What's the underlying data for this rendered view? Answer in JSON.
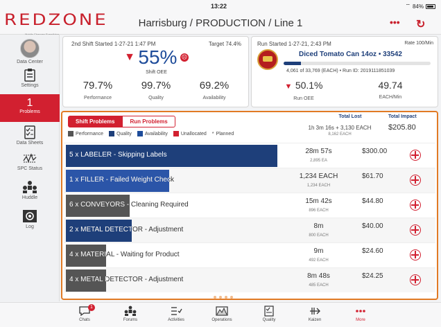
{
  "status_bar": {
    "time": "13:22",
    "battery": "84%"
  },
  "logo": {
    "text": "REDZONE",
    "tagline": "Mobile Changes Everything."
  },
  "header": {
    "title": "Harrisburg / PRODUCTION / Line 1",
    "more": "•••",
    "refresh": "↻"
  },
  "sidebar": {
    "items": [
      {
        "label": "Data Center",
        "icon": "user-avatar"
      },
      {
        "label": "Settings",
        "icon": "clipboard-icon"
      },
      {
        "label": "Problems",
        "count": "1",
        "icon": "problems"
      },
      {
        "label": "Data Sheets",
        "icon": "checklist-icon"
      },
      {
        "label": "SPC Status",
        "icon": "spc-chart-icon"
      },
      {
        "label": "Huddle",
        "icon": "huddle-icon"
      },
      {
        "label": "Log",
        "icon": "log-icon"
      }
    ]
  },
  "shift": {
    "started": "2nd Shift Started 1-27-21 1:47 PM",
    "target": "Target 74.4%",
    "oee": "55%",
    "oee_label": "Shift OEE",
    "metrics": [
      {
        "value": "79.7%",
        "label": "Performance"
      },
      {
        "value": "99.7%",
        "label": "Quality"
      },
      {
        "value": "69.2%",
        "label": "Availability"
      }
    ]
  },
  "run": {
    "started": "Run Started 1-27-21, 2:43 PM",
    "rate": "Rate 100/Min",
    "product": "Diced Tomato Can 14oz • 33542",
    "progress_fraction": 0.12,
    "count": "4,061 of 33,769 (EACH) • Run ID: 2019111851039",
    "oee": "50.1%",
    "oee_label": "Run OEE",
    "each_min": "49.74",
    "each_min_label": "EACH/Min"
  },
  "problems": {
    "tabs": [
      {
        "label": "Shift Problems",
        "active": true
      },
      {
        "label": "Run Problems",
        "active": false
      }
    ],
    "legend": [
      {
        "label": "Performance",
        "color": "#555555"
      },
      {
        "label": "Quality",
        "color": "#1e3f7a"
      },
      {
        "label": "Availability",
        "color": "#1e4c9a"
      },
      {
        "label": "Unallocated",
        "color": "#d22030"
      },
      {
        "label": "Planned",
        "marker": "*"
      }
    ],
    "headers": {
      "total_lost": "Total Lost",
      "total_impact": "Total Impact"
    },
    "totals": {
      "lost": "1h 3m 16s + 3,130 EACH",
      "each": "8,162 EACH",
      "impact": "$205.80"
    },
    "rows": [
      {
        "label": "5 x LABELER - Skipping Labels",
        "lost": "28m 57s",
        "lost_sub": "2,895 EA",
        "impact": "$300.00",
        "color": "#1e3f7a",
        "bar_fraction": 1.0
      },
      {
        "label": "1 x FILLER - Failed Weight Check",
        "lost": "1,234 EACH",
        "lost_sub": "1,234 EACH",
        "impact": "$61.70",
        "color": "#2b55a8",
        "bar_fraction": 0.49
      },
      {
        "label": "6 x CONVEYORS - Cleaning Required",
        "lost": "15m 42s",
        "lost_sub": "896 EACH",
        "impact": "$44.80",
        "color": "#555555",
        "bar_fraction": 0.3
      },
      {
        "label": "2 x METAL DETECTOR - Adjustment",
        "lost": "8m",
        "lost_sub": "800 EACH",
        "impact": "$40.00",
        "color": "#1e3f7a",
        "bar_fraction": 0.31
      },
      {
        "label": "4 x MATERIAL - Waiting for Product",
        "lost": "9m",
        "lost_sub": "492 EACH",
        "impact": "$24.60",
        "color": "#555555",
        "bar_fraction": 0.19
      },
      {
        "label": "4 x METAL DETECTOR - Adjustment",
        "lost": "8m 48s",
        "lost_sub": "485 EACH",
        "impact": "$24.25",
        "color": "#555555",
        "bar_fraction": 0.19
      }
    ]
  },
  "bottom_nav": [
    {
      "label": "Chats",
      "badge": "1",
      "icon": "chat-icon"
    },
    {
      "label": "Forums",
      "icon": "forums-icon"
    },
    {
      "label": "Activities",
      "icon": "activities-icon"
    },
    {
      "label": "Operations",
      "icon": "operations-icon"
    },
    {
      "label": "Quality",
      "icon": "quality-icon"
    },
    {
      "label": "Kaizen",
      "icon": "kaizen-icon"
    },
    {
      "label": "More",
      "icon": "more-dots-icon"
    }
  ]
}
